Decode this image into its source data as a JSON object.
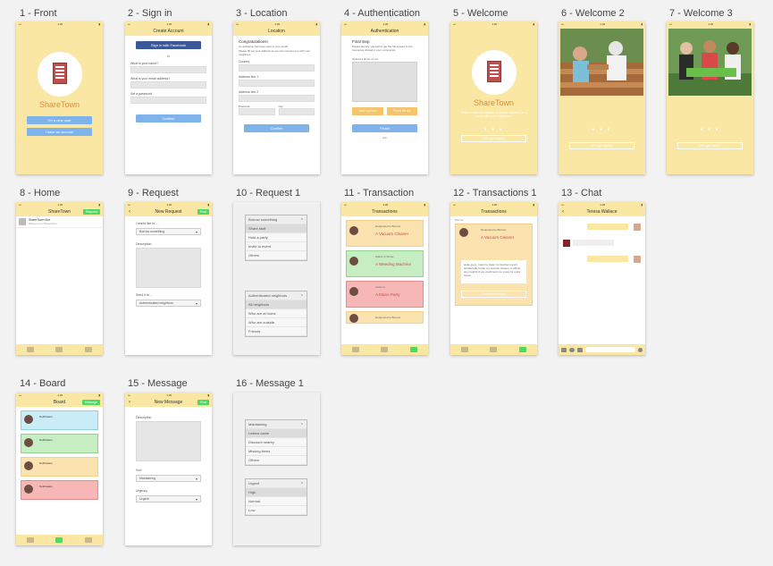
{
  "artboards": [
    {
      "label": "1 - Front"
    },
    {
      "label": "2 - Sign in"
    },
    {
      "label": "3 - Location"
    },
    {
      "label": "4 - Authentication"
    },
    {
      "label": "5 - Welcome"
    },
    {
      "label": "6 - Welcome 2"
    },
    {
      "label": "7 - Welcome 3"
    },
    {
      "label": "8 - Home"
    },
    {
      "label": "9 - Request"
    },
    {
      "label": "10 - Request 1"
    },
    {
      "label": "11 - Transaction"
    },
    {
      "label": "12 - Transactions 1"
    },
    {
      "label": "13 - Chat"
    },
    {
      "label": "14 - Board"
    },
    {
      "label": "15 - Message"
    },
    {
      "label": "16 - Message 1"
    }
  ],
  "front": {
    "brand": "ShareTown",
    "btn1": "I'm a new user",
    "btn2": "I have an account"
  },
  "signin": {
    "title": "Create Account",
    "fb": "Sign in with Facebook",
    "or": "or",
    "f1": "What is your name?",
    "f2": "What is your email address?",
    "f3": "Set a password",
    "confirm": "Confirm"
  },
  "location": {
    "title": "Location",
    "heading": "Congratulations!",
    "line1": "An activation has been sent to your email.",
    "line2": "Please fill out your address so we can connect you with your neighbors.",
    "country": "Country",
    "addr1": "Address line 1",
    "addr2": "Address line 2",
    "postal": "Postcode",
    "city": "City",
    "confirm": "Confirm"
  },
  "auth": {
    "title": "Authentication",
    "heading": "Final step",
    "line": "Please identify yourself to get the full access to the resources shared in your community.",
    "upload": "Upload a photo of you",
    "take": "Take a photo",
    "photos": "Photo library",
    "finish": "Finish",
    "skip": "skip"
  },
  "welcome": {
    "brand": "ShareTown",
    "text": "Share a vacuum cleaner, a broken hammer or a party with your neighbors.",
    "dots": "● ● ●",
    "cta": "Let's get started"
  },
  "welcome2": {
    "dots": "● ● ●",
    "cta": "Let's get started"
  },
  "welcome3": {
    "dots": "● ● ●",
    "cta": "Let's get started"
  },
  "home": {
    "title": "ShareTown",
    "btn": "Request",
    "item": "ShareTown Bot",
    "sub": "Welcome to ShareTown"
  },
  "request": {
    "title": "New Request",
    "back": "‹",
    "btn": "Post",
    "q": "I would like to ...",
    "dd1": "Borrow something",
    "desc": "Description",
    "send": "Send it to ...",
    "dd2": "Authenticated neighbors"
  },
  "request1": {
    "picker1": [
      "Borrow something",
      "Share stuff",
      "Hold a party",
      "Invite to event",
      "Others"
    ],
    "picker2": [
      "Authenticated neighbors",
      "All neighbors",
      "Who are at home",
      "Who are outside",
      "Friends"
    ]
  },
  "transaction": {
    "title": "Transactions",
    "cards": [
      {
        "who": "Borrow",
        "sub": "Requested to Borrow",
        "item": "A Vacuum Cleaner",
        "cls": "yellow"
      },
      {
        "who": "Share",
        "sub": "Wants to Share",
        "item": "A Weeding Machine",
        "cls": "green"
      },
      {
        "who": "Party",
        "sub": "Invite to",
        "item": "A Music Party",
        "cls": "red"
      },
      {
        "who": "Borrow",
        "sub": "Requested to Borrow",
        "item": "",
        "cls": "yellow"
      }
    ]
  },
  "transaction1": {
    "title": "Transactions",
    "label": "Borrow",
    "sub": "Requested to Borrow",
    "item": "A Vacuum Cleaner",
    "msg": "Hello guys, I want to clean my bedroom and I accidentally broke my vacuum cleaner. It will be very helpful if you could lend me yours for a few hours.",
    "reply": "Send a message"
  },
  "chat": {
    "title": "Teresa Wallace",
    "back": "‹"
  },
  "board": {
    "title": "Board",
    "btn": "Message",
    "cards": [
      {
        "who": "Manager",
        "head": "Notification",
        "cls": "blue"
      },
      {
        "who": "Willa",
        "head": "Notification",
        "cls": "green"
      },
      {
        "who": "Christina",
        "head": "Notification",
        "cls": "yellow"
      },
      {
        "who": "Bob",
        "head": "Notification",
        "cls": "red"
      }
    ]
  },
  "message": {
    "title": "New Message",
    "back": "‹",
    "btn": "Post",
    "desc": "Description",
    "sort": "Sort",
    "dd1": "Maintaining",
    "urgency": "Urgency",
    "dd2": "Urgent"
  },
  "message1": {
    "picker1": [
      "Maintaining",
      "Letters came",
      "Discount nearby",
      "Missing items",
      "Others"
    ],
    "picker2": [
      "Urgent",
      "High",
      "Normal",
      "Low"
    ]
  }
}
